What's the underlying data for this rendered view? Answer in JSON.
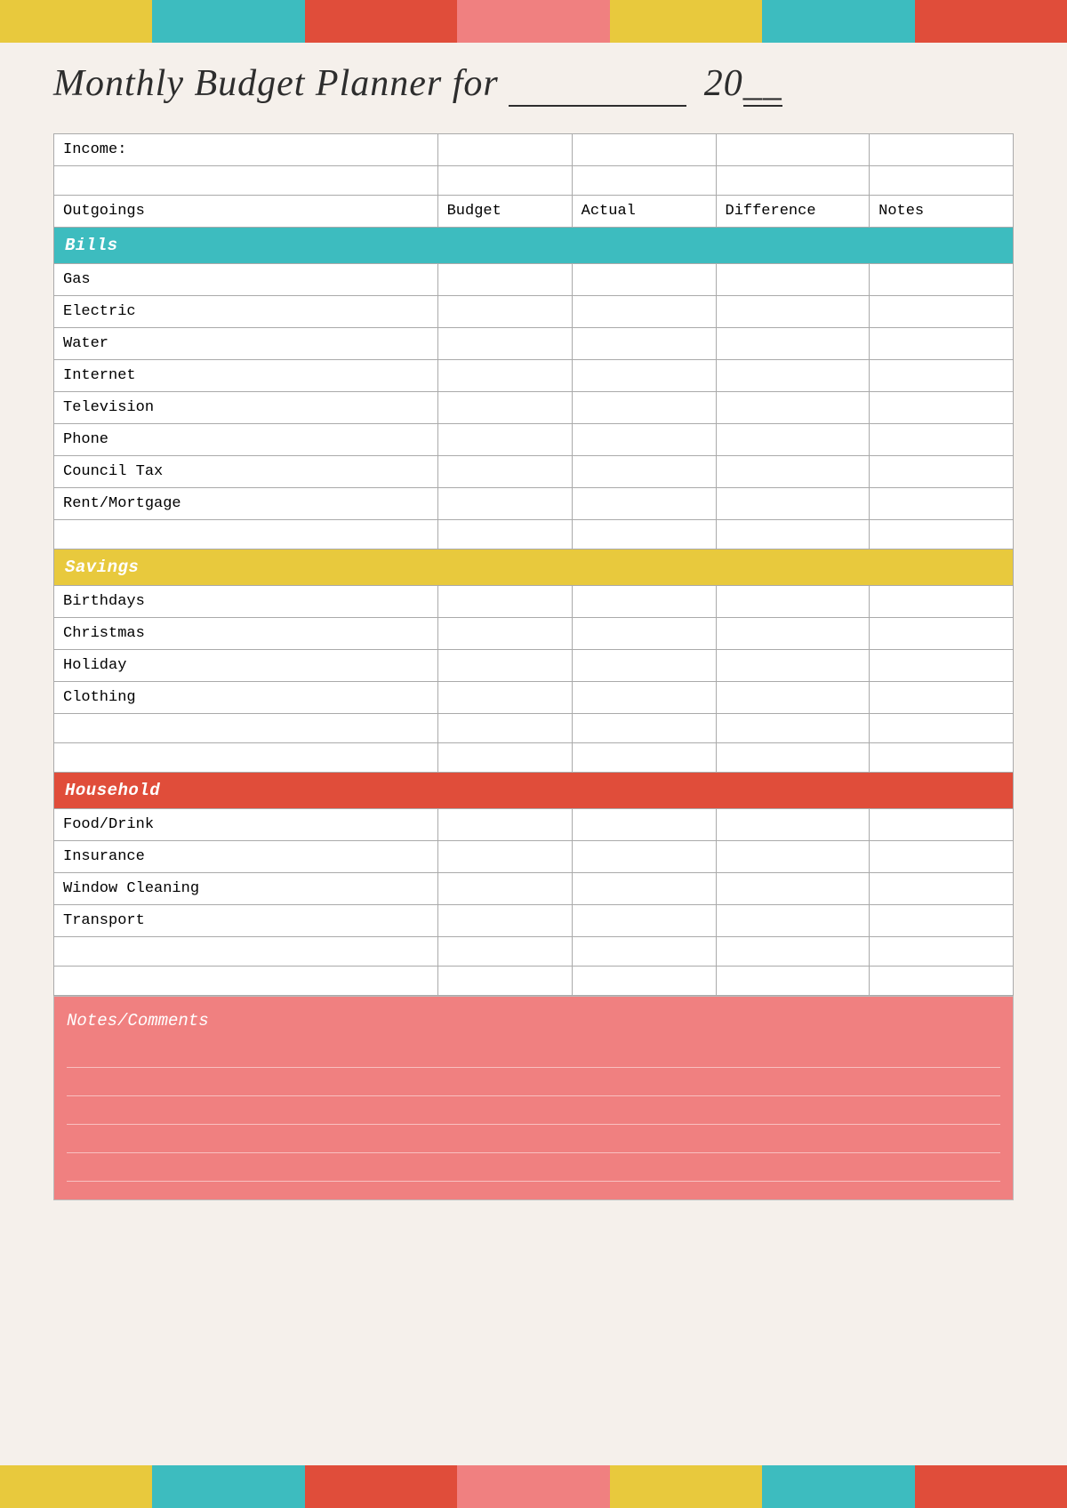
{
  "colorBarsTop": [
    {
      "color": "cb-yellow",
      "label": "yellow"
    },
    {
      "color": "cb-teal",
      "label": "teal"
    },
    {
      "color": "cb-red",
      "label": "red"
    },
    {
      "color": "cb-pink",
      "label": "pink"
    },
    {
      "color": "cb-yellow2",
      "label": "yellow2"
    },
    {
      "color": "cb-teal2",
      "label": "teal2"
    },
    {
      "color": "cb-red2",
      "label": "red2"
    }
  ],
  "title": "Monthly Budget Planner for",
  "title_for": "_________",
  "title_year": "20",
  "title_year_blank": "__",
  "income_label": "Income:",
  "columns": {
    "outgoings": "Outgoings",
    "budget": "Budget",
    "actual": "Actual",
    "difference": "Difference",
    "notes": "Notes"
  },
  "sections": {
    "bills": {
      "label": "Bills",
      "items": [
        "Gas",
        "Electric",
        "Water",
        "Internet",
        "Television",
        "Phone",
        "Council Tax",
        "Rent/Mortgage"
      ]
    },
    "savings": {
      "label": "Savings",
      "items": [
        "Birthdays",
        "Christmas",
        "Holiday",
        "Clothing"
      ]
    },
    "household": {
      "label": "Household",
      "items": [
        "Food/Drink",
        "Insurance",
        "Window Cleaning",
        "Transport"
      ]
    }
  },
  "notes_label": "Notes/Comments",
  "notes_lines": 5
}
